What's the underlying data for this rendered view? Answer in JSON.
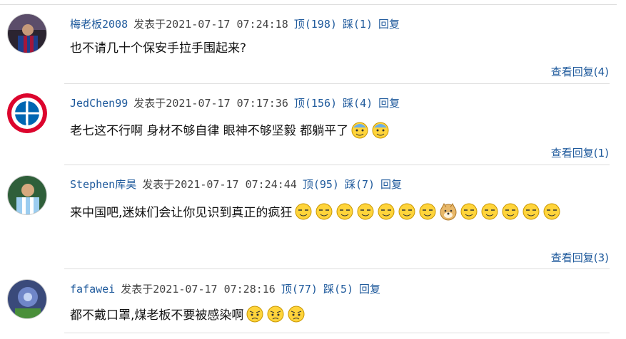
{
  "comments": [
    {
      "user": "梅老板2008",
      "posted_label": "发表于",
      "datetime": "2021-07-17 07:24:18",
      "up_label": "顶(198)",
      "down_label": "踩(1)",
      "reply_label": "回复",
      "text": "也不请几十个保安手拉手围起来?",
      "emoticons": [],
      "view_replies": "查看回复(4)"
    },
    {
      "user": "JedChen99",
      "posted_label": "发表于",
      "datetime": "2021-07-17 07:17:36",
      "up_label": "顶(156)",
      "down_label": "踩(4)",
      "reply_label": "回复",
      "text": "老七这不行啊 身材不够自律 眼神不够坚毅 都躺平了",
      "emoticons": [
        "sweat-smile-icon",
        "sweat-smile-icon"
      ],
      "view_replies": "查看回复(1)"
    },
    {
      "user": "Stephen库昊",
      "posted_label": "发表于",
      "datetime": "2021-07-17 07:24:44",
      "up_label": "顶(95)",
      "down_label": "踩(7)",
      "reply_label": "回复",
      "text": "来中国吧,迷妹们会让你见识到真正的疯狂",
      "emoticons": [
        "smug-face-icon",
        "smug-face-icon",
        "smug-face-icon",
        "smug-face-icon",
        "smug-face-icon",
        "smug-face-icon",
        "smug-face-icon",
        "doge-icon",
        "smug-face-icon",
        "smug-face-icon",
        "smug-face-icon",
        "smug-face-icon",
        "smug-face-icon"
      ],
      "view_replies": "查看回复(3)"
    },
    {
      "user": "fafawei",
      "posted_label": "发表于",
      "datetime": "2021-07-17 07:28:16",
      "up_label": "顶(77)",
      "down_label": "踩(5)",
      "reply_label": "回复",
      "text": "都不戴口罩,煤老板不要被感染啊",
      "emoticons": [
        "worried-face-icon",
        "worried-face-icon",
        "worried-face-icon"
      ],
      "view_replies": ""
    }
  ]
}
